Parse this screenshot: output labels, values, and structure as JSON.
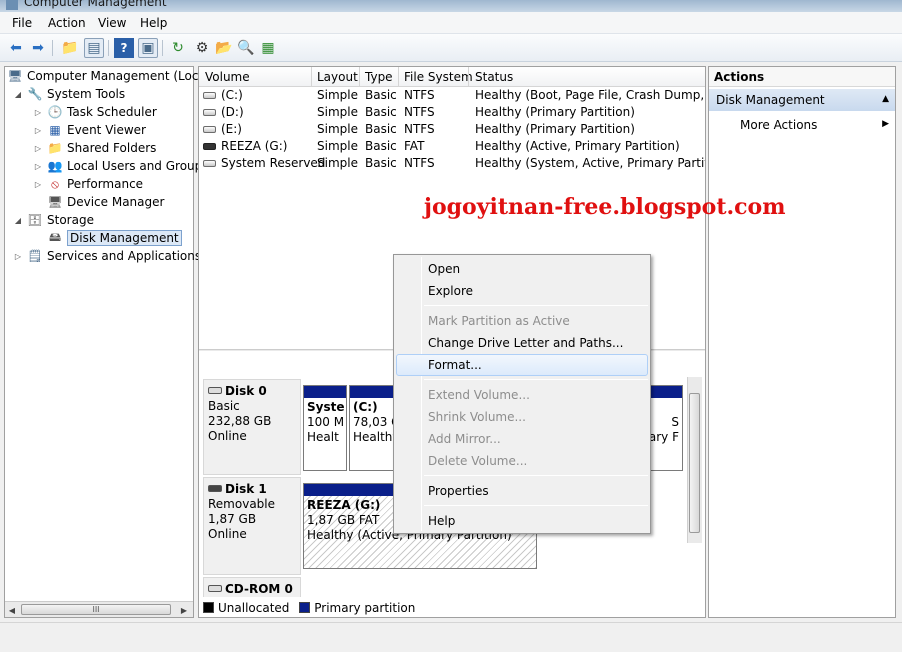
{
  "window": {
    "title": "Computer Management"
  },
  "menu": [
    "File",
    "Action",
    "View",
    "Help"
  ],
  "tree": {
    "root": "Computer Management (Local",
    "system_tools": "System Tools",
    "task_scheduler": "Task Scheduler",
    "event_viewer": "Event Viewer",
    "shared_folders": "Shared Folders",
    "local_users": "Local Users and Groups",
    "performance": "Performance",
    "device_manager": "Device Manager",
    "storage": "Storage",
    "disk_management": "Disk Management",
    "services": "Services and Applications"
  },
  "volumes": {
    "columns": [
      "Volume",
      "Layout",
      "Type",
      "File System",
      "Status"
    ],
    "rows": [
      {
        "volume": "(C:)",
        "layout": "Simple",
        "type": "Basic",
        "fs": "NTFS",
        "status": "Healthy (Boot, Page File, Crash Dump, Prim"
      },
      {
        "volume": "(D:)",
        "layout": "Simple",
        "type": "Basic",
        "fs": "NTFS",
        "status": "Healthy (Primary Partition)"
      },
      {
        "volume": "(E:)",
        "layout": "Simple",
        "type": "Basic",
        "fs": "NTFS",
        "status": "Healthy (Primary Partition)"
      },
      {
        "volume": "REEZA (G:)",
        "layout": "Simple",
        "type": "Basic",
        "fs": "FAT",
        "status": "Healthy (Active, Primary Partition)"
      },
      {
        "volume": "System Reserved",
        "layout": "Simple",
        "type": "Basic",
        "fs": "NTFS",
        "status": "Healthy (System, Active, Primary Partition)"
      }
    ]
  },
  "watermark": "jogoyitnan-free.blogspot.com",
  "scroll_grip": "III",
  "disks": {
    "disk0": {
      "name": "Disk 0",
      "type": "Basic",
      "size": "232,88 GB",
      "state": "Online",
      "part_sys": {
        "name": "Syste",
        "size": "100 M",
        "status": "Healt"
      },
      "part_c": {
        "name": "(C:)",
        "size": "78,03 G",
        "status": "Healthy"
      },
      "part_tail": {
        "size": "S",
        "status": "ary F"
      }
    },
    "disk1": {
      "name": "Disk 1",
      "type": "Removable",
      "size": "1,87 GB",
      "state": "Online",
      "part_g": {
        "name": "REEZA  (G:)",
        "size": "1,87 GB FAT",
        "status": "Healthy (Active, Primary Partition)"
      }
    },
    "cdrom": {
      "name": "CD-ROM 0"
    }
  },
  "legend": {
    "unallocated": "Unallocated",
    "primary": "Primary partition",
    "unallocated_color": "#000000",
    "primary_color": "#0a1f8a"
  },
  "actions": {
    "title": "Actions",
    "section": "Disk Management",
    "more": "More Actions"
  },
  "context_menu": {
    "open": "Open",
    "explore": "Explore",
    "mark_active": "Mark Partition as Active",
    "change_letter": "Change Drive Letter and Paths...",
    "format": "Format...",
    "extend": "Extend Volume...",
    "shrink": "Shrink Volume...",
    "add_mirror": "Add Mirror...",
    "delete": "Delete Volume...",
    "properties": "Properties",
    "help": "Help"
  }
}
